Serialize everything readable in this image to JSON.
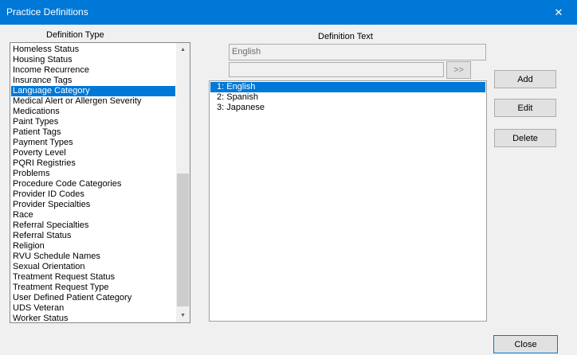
{
  "window": {
    "title": "Practice Definitions",
    "close_glyph": "✕"
  },
  "definition_type": {
    "label": "Definition Type",
    "items": [
      "Homeless Status",
      "Housing Status",
      "Income Recurrence",
      "Insurance Tags",
      "Language Category",
      "Medical Alert or Allergen Severity",
      "Medications",
      "Paint Types",
      "Patient Tags",
      "Payment Types",
      "Poverty Level",
      "PQRI Registries",
      "Problems",
      "Procedure Code Categories",
      "Provider ID Codes",
      "Provider Specialties",
      "Race",
      "Referral Specialties",
      "Referral Status",
      "Religion",
      "RVU Schedule Names",
      "Sexual Orientation",
      "Treatment Request Status",
      "Treatment Request Type",
      "User Defined Patient Category",
      "UDS Veteran",
      "Worker Status"
    ],
    "selected_index": 4,
    "scroll_up_icon": "▲",
    "scroll_down_icon": "▼"
  },
  "definition_text": {
    "label": "Definition Text",
    "field1_value": "English",
    "field2_value": "",
    "move_button": ">>",
    "items": [
      "1: English",
      "2: Spanish",
      "3: Japanese"
    ],
    "selected_index": 0
  },
  "buttons": {
    "add": "Add",
    "edit": "Edit",
    "delete": "Delete",
    "close": "Close"
  }
}
